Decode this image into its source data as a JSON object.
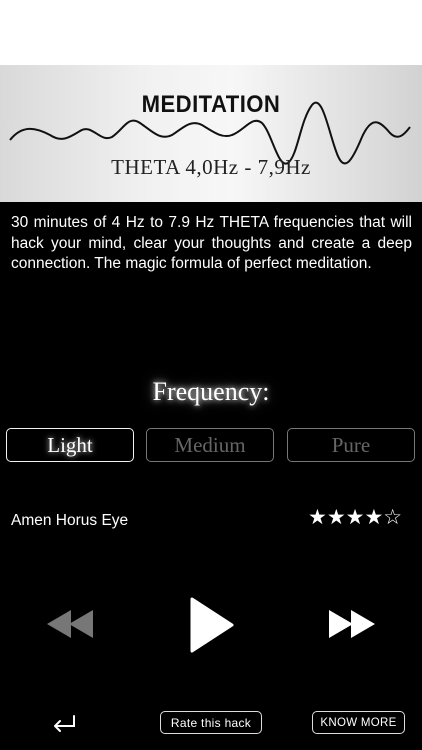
{
  "banner": {
    "title": "MEDITATION",
    "subtitle": "THETA 4,0Hz - 7,9Hz"
  },
  "description": "30 minutes of 4 Hz to 7.9 Hz THETA frequencies that will hack your mind, clear your thoughts and create a deep connection. The magic formula of perfect meditation.",
  "frequency": {
    "title": "Frequency:",
    "options": [
      "Light",
      "Medium",
      "Pure"
    ],
    "selected": "Light"
  },
  "track": {
    "name": "Amen Horus Eye",
    "rating": 4,
    "max_rating": 5,
    "stars_display": "★★★★☆"
  },
  "controls": {
    "rewind": "rewind-icon",
    "play": "play-icon",
    "forward": "fast-forward-icon"
  },
  "footer": {
    "back": "return-arrow-icon",
    "rate_label": "Rate this hack",
    "know_more_label": "KNOW MORE"
  },
  "colors": {
    "background": "#000000",
    "banner": "#f0f0f0",
    "accent": "#ffffff",
    "inactive": "#666666"
  }
}
